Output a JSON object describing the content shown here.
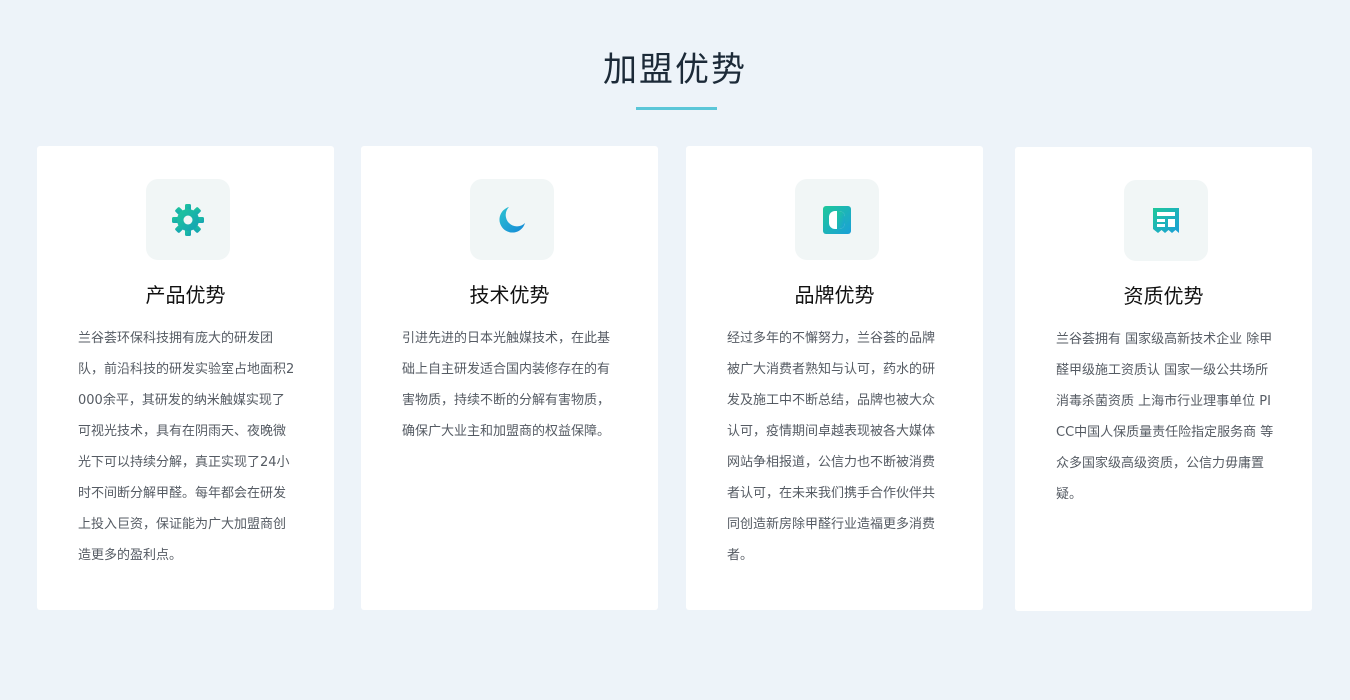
{
  "section": {
    "title": "加盟优势"
  },
  "colors": {
    "background": "#edf3f9",
    "accent": "#5bc6d8",
    "icon_gradient_start": "#1fc89a",
    "icon_gradient_end": "#1a9fd8"
  },
  "cards": [
    {
      "icon": "gear-icon",
      "title": "产品优势",
      "text": "兰谷荟环保科技拥有庞大的研发团队，前沿科技的研发实验室占地面积2000余平，其研发的纳米触媒实现了可视光技术，具有在阴雨天、夜晚微光下可以持续分解，真正实现了24小时不间断分解甲醛。每年都会在研发上投入巨资，保证能为广大加盟商创造更多的盈利点。"
    },
    {
      "icon": "crescent-moon-icon",
      "title": "技术优势",
      "text": "引进先进的日本光触媒技术，在此基础上自主研发适合国内装修存在的有害物质，持续不断的分解有害物质，确保广大业主和加盟商的权益保障。"
    },
    {
      "icon": "contrast-icon",
      "title": "品牌优势",
      "text": "经过多年的不懈努力，兰谷荟的品牌被广大消费者熟知与认可，药水的研发及施工中不断总结，品牌也被大众认可，疫情期间卓越表现被各大媒体网站争相报道，公信力也不断被消费者认可，在未来我们携手合作伙伴共同创造新房除甲醛行业造福更多消费者。"
    },
    {
      "icon": "newspaper-icon",
      "title": "资质优势",
      "text": "兰谷荟拥有 国家级高新技术企业 除甲醛甲级施工资质认 国家一级公共场所消毒杀菌资质 上海市行业理事单位 PICC中国人保质量责任险指定服务商 等众多国家级高级资质，公信力毋庸置疑。"
    }
  ]
}
